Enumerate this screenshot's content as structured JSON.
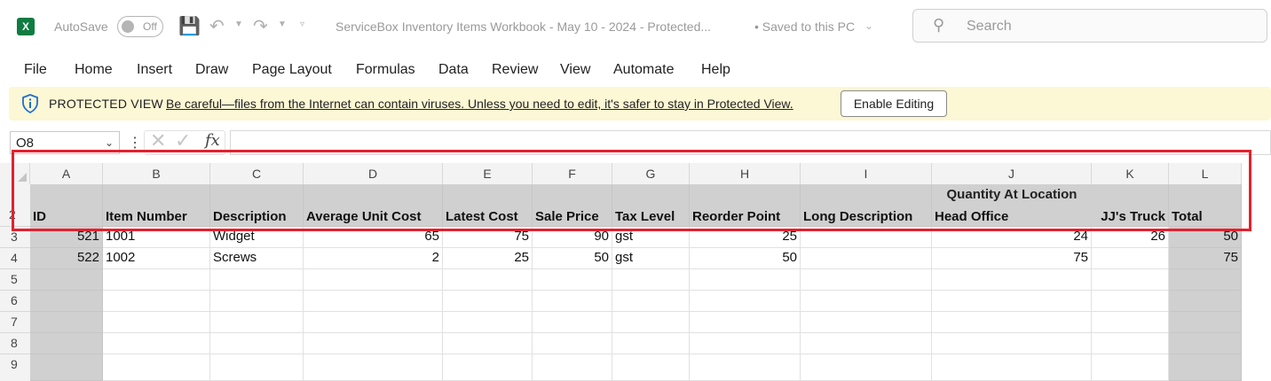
{
  "titlebar": {
    "app_logo": "X",
    "autosave_label": "AutoSave",
    "autosave_state": "Off",
    "doc_title": "ServiceBox Inventory Items Workbook - May 10 - 2024  -  Protected...",
    "saved_status": "• Saved to this PC",
    "search_placeholder": "Search"
  },
  "ribbon": {
    "tabs": [
      "File",
      "Home",
      "Insert",
      "Draw",
      "Page Layout",
      "Formulas",
      "Data",
      "Review",
      "View",
      "Automate",
      "Help"
    ]
  },
  "protected_view": {
    "title": "PROTECTED VIEW",
    "message": "Be careful—files from the Internet can contain viruses. Unless you need to edit, it's safer to stay in Protected View.",
    "button": "Enable Editing"
  },
  "formula_bar": {
    "name_box": "O8",
    "fx": "fx",
    "formula": ""
  },
  "sheet": {
    "columns": [
      "A",
      "B",
      "C",
      "D",
      "E",
      "F",
      "G",
      "H",
      "I",
      "J",
      "K",
      "L"
    ],
    "rows": [
      "2",
      "3",
      "4",
      "5",
      "6",
      "7",
      "8",
      "9"
    ],
    "group_header": "Quantity At Location",
    "headers": [
      "ID",
      "Item Number",
      "Description",
      "Average Unit Cost",
      "Latest Cost",
      "Sale Price",
      "Tax Level",
      "Reorder Point",
      "Long Description",
      "Head Office",
      "JJ's Truck",
      "Total"
    ],
    "data": [
      [
        "521",
        "1001",
        "Widget",
        "65",
        "75",
        "90",
        "gst",
        "25",
        "",
        "24",
        "26",
        "50"
      ],
      [
        "522",
        "1002",
        "Screws",
        "2",
        "25",
        "50",
        "gst",
        "50",
        "",
        "75",
        "",
        "75"
      ]
    ]
  },
  "colors": {
    "excel_green": "#107c41",
    "protected_bar": "#fcf7d4",
    "highlight": "#e5202e",
    "grey_column": "#d0d0d0"
  }
}
